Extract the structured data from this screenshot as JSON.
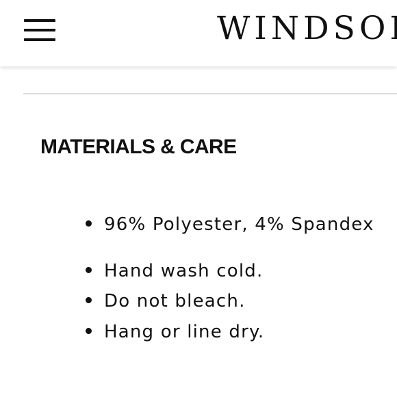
{
  "header": {
    "brand": "WINDSOR",
    "menu_icon": "hamburger-menu-icon"
  },
  "section": {
    "title": "MATERIALS & CARE",
    "items": [
      "96% Polyester, 4% Spandex",
      "Hand wash cold.",
      "Do not bleach.",
      "Hang or line dry."
    ]
  }
}
